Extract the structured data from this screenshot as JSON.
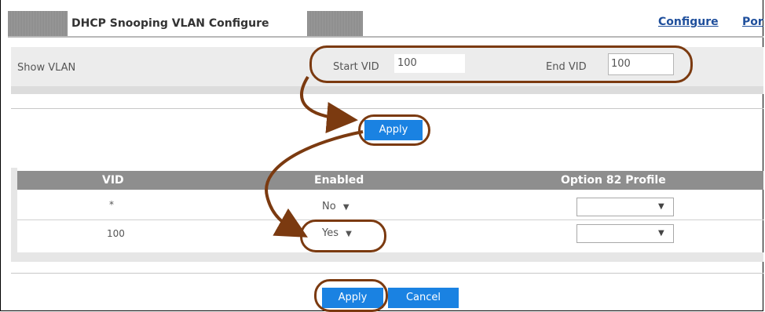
{
  "header": {
    "title": "DHCP Snooping VLAN Configure",
    "links": [
      "Configure",
      "Por"
    ]
  },
  "show_vlan": {
    "label": "Show VLAN",
    "start_label": "Start VID",
    "start_value": "100",
    "end_label": "End VID",
    "end_value": "100",
    "apply_label": "Apply"
  },
  "table": {
    "columns": [
      "VID",
      "Enabled",
      "Option 82 Profile"
    ],
    "rows": [
      {
        "vid": "*",
        "enabled": "No",
        "profile": ""
      },
      {
        "vid": "100",
        "enabled": "Yes",
        "profile": ""
      }
    ]
  },
  "footer": {
    "apply_label": "Apply",
    "cancel_label": "Cancel"
  },
  "colors": {
    "annotation": "#7b3a10",
    "button": "#1a82e2",
    "table_header": "#8e8e8e"
  }
}
